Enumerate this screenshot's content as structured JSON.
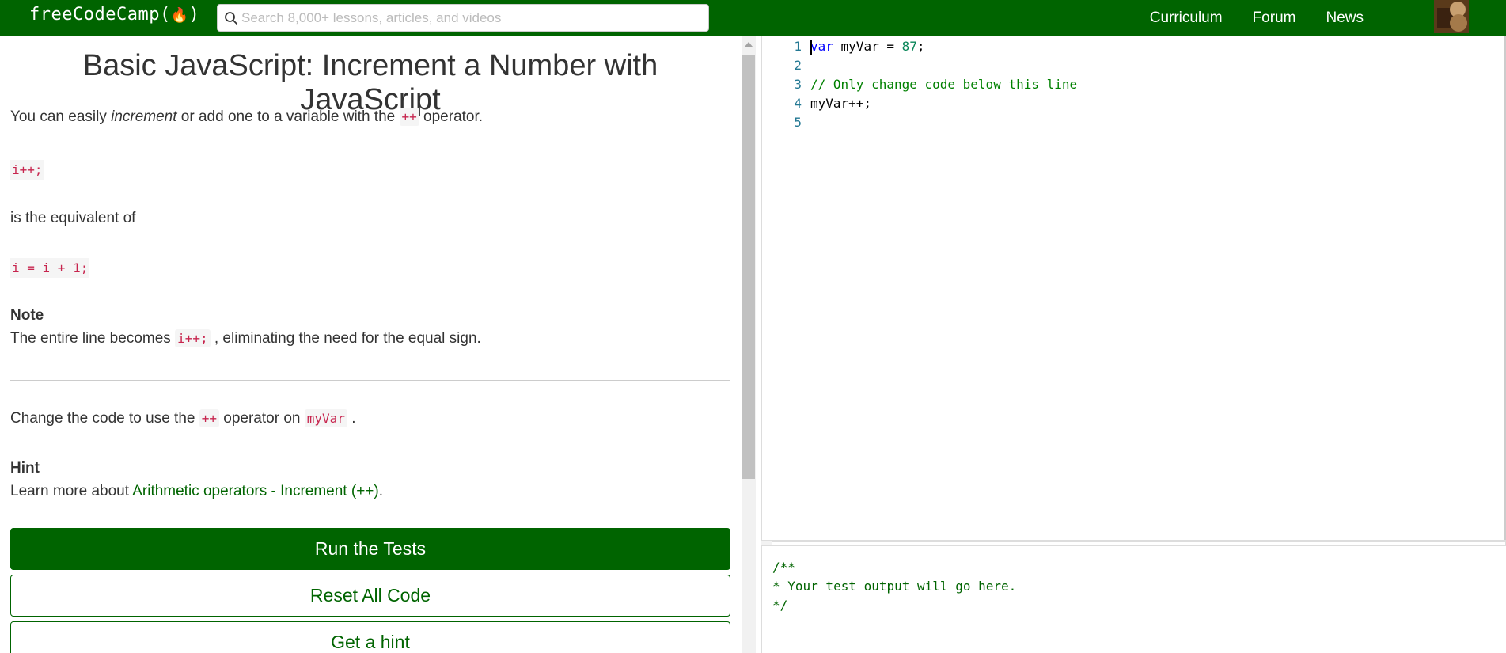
{
  "navbar": {
    "logo_text": "freeCodeCamp(",
    "logo_flame": "🔥",
    "logo_close": ")",
    "search_placeholder": "Search 8,000+ lessons, articles, and videos",
    "links": [
      "Curriculum",
      "Forum",
      "News"
    ]
  },
  "challenge": {
    "title": "Basic JavaScript: Increment a Number with JavaScript",
    "intro_pre": "You can easily ",
    "intro_em": "increment",
    "intro_mid": " or add one to a variable with the ",
    "intro_code": "++",
    "intro_post": " operator.",
    "example_1": "i++;",
    "equivalent_text": "is the equivalent of",
    "example_2": "i = i + 1;",
    "note_heading": "Note",
    "note_pre": "The entire line becomes ",
    "note_code": "i++;",
    "note_post": " , eliminating the need for the equal sign.",
    "instr_pre": "Change the code to use the ",
    "instr_code_1": "++",
    "instr_mid": " operator on ",
    "instr_code_2": "myVar",
    "instr_post": " .",
    "hint_heading": "Hint",
    "hint_pre": "Learn more about ",
    "hint_link": "Arithmetic operators - Increment (++)",
    "hint_post": "."
  },
  "buttons": {
    "run": "Run the Tests",
    "reset": "Reset All Code",
    "hint": "Get a hint"
  },
  "editor": {
    "lines": [
      {
        "num": "1",
        "kw": "var",
        "rest": " myVar = ",
        "num_val": "87",
        "end": ";"
      },
      {
        "num": "2",
        "text": ""
      },
      {
        "num": "3",
        "comment": "// Only change code below this line"
      },
      {
        "num": "4",
        "text": "myVar++;"
      },
      {
        "num": "5",
        "text": ""
      }
    ]
  },
  "output": {
    "text": "/**\n* Your test output will go here.\n*/"
  },
  "colors": {
    "brand": "#006400",
    "code_text": "#c7254e",
    "line_numbers": "#237893"
  }
}
